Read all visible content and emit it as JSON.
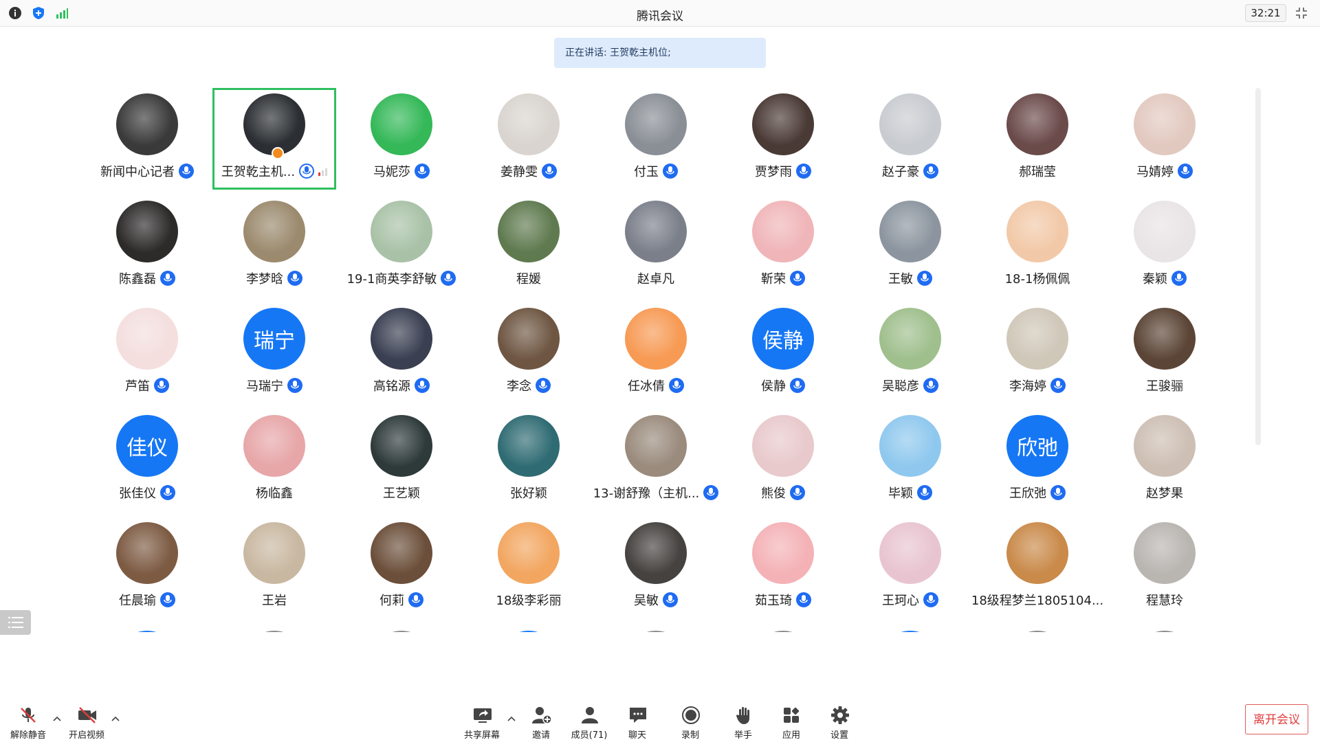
{
  "window": {
    "title": "腾讯会议",
    "timer": "32:21",
    "icons": [
      "info-icon",
      "shield-icon",
      "signal-icon",
      "fullscreen-icon"
    ]
  },
  "banner": {
    "text": "正在讲话: 王贺乾主机位;"
  },
  "colors": {
    "accent": "#1677f5",
    "active_border": "#2fbf5f",
    "banner_bg": "#deebfc",
    "leave": "#e03c3c",
    "host_badge": "#f28b1d"
  },
  "participants": [
    {
      "name": "新闻中心记者",
      "mic": true,
      "bg": "#3a3a3a"
    },
    {
      "name": "王贺乾主机...",
      "mic": "outline",
      "bg": "#2b2f33",
      "active": true,
      "host": true,
      "signal": true
    },
    {
      "name": "马妮莎",
      "mic": true,
      "bg": "#34b858"
    },
    {
      "name": "姜静雯",
      "mic": true,
      "bg": "#d9d4cf"
    },
    {
      "name": "付玉",
      "mic": true,
      "bg": "#8a8f96"
    },
    {
      "name": "贾梦雨",
      "mic": true,
      "bg": "#4a3a36"
    },
    {
      "name": "赵子豪",
      "mic": true,
      "bg": "#c8cbd0"
    },
    {
      "name": "郝瑞莹",
      "mic": false,
      "bg": "#6b4a4a"
    },
    {
      "name": "马婧婷",
      "mic": true,
      "bg": "#e2c9c0"
    },
    {
      "name": "陈鑫磊",
      "mic": true,
      "bg": "#2d2a2a"
    },
    {
      "name": "李梦晗",
      "mic": true,
      "bg": "#9b8a6e"
    },
    {
      "name": "19-1商英李舒敏",
      "mic": true,
      "bg": "#a9c2a7"
    },
    {
      "name": "程媛",
      "mic": false,
      "bg": "#5f7a4f"
    },
    {
      "name": "赵卓凡",
      "mic": false,
      "bg": "#7b7f8a"
    },
    {
      "name": "靳荣",
      "mic": true,
      "bg": "#f0b5b8"
    },
    {
      "name": "王敏",
      "mic": true,
      "bg": "#8c959f"
    },
    {
      "name": "18-1杨佩佩",
      "mic": false,
      "bg": "#f2c9a8"
    },
    {
      "name": "秦颖",
      "mic": true,
      "bg": "#e9e4e6"
    },
    {
      "name": "芦笛",
      "mic": true,
      "bg": "#f4dede"
    },
    {
      "name": "马瑞宁",
      "mic": true,
      "text": "瑞宁"
    },
    {
      "name": "高铭源",
      "mic": true,
      "bg": "#3a3f52"
    },
    {
      "name": "李念",
      "mic": true,
      "bg": "#6e5642"
    },
    {
      "name": "任冰倩",
      "mic": true,
      "bg": "#f79a54"
    },
    {
      "name": "侯静",
      "mic": true,
      "text": "侯静"
    },
    {
      "name": "吴聪彦",
      "mic": true,
      "bg": "#9fbf8d"
    },
    {
      "name": "李海婷",
      "mic": true,
      "bg": "#cfc7b8"
    },
    {
      "name": "王骏骊",
      "mic": false,
      "bg": "#5b4536"
    },
    {
      "name": "张佳仪",
      "mic": true,
      "text": "佳仪"
    },
    {
      "name": "杨临鑫",
      "mic": false,
      "bg": "#e7a6a8"
    },
    {
      "name": "王艺颖",
      "mic": false,
      "bg": "#2e3a3a"
    },
    {
      "name": "张好颖",
      "mic": false,
      "bg": "#2f6b73"
    },
    {
      "name": "13-谢舒豫（主机...",
      "mic": true,
      "bg": "#9a8b7d"
    },
    {
      "name": "熊俊",
      "mic": true,
      "bg": "#e8c9cc"
    },
    {
      "name": "毕颖",
      "mic": true,
      "bg": "#8fc8ee"
    },
    {
      "name": "王欣弛",
      "mic": true,
      "text": "欣弛"
    },
    {
      "name": "赵梦果",
      "mic": false,
      "bg": "#cdbfb4"
    },
    {
      "name": "任晨瑜",
      "mic": true,
      "bg": "#7d5b43"
    },
    {
      "name": "王岩",
      "mic": false,
      "bg": "#c9b8a1"
    },
    {
      "name": "何莉",
      "mic": true,
      "bg": "#6b4f3a"
    },
    {
      "name": "18级李彩丽",
      "mic": false,
      "bg": "#f2a660"
    },
    {
      "name": "吴敏",
      "mic": true,
      "bg": "#45423f"
    },
    {
      "name": "茹玉琦",
      "mic": true,
      "bg": "#f4b2b6"
    },
    {
      "name": "王珂心",
      "mic": true,
      "bg": "#e8c4d1"
    },
    {
      "name": "18级程梦兰1805104...",
      "mic": false,
      "bg": "#c98a4a"
    },
    {
      "name": "程慧玲",
      "mic": false,
      "bg": "#b9b5b1"
    }
  ],
  "toolbar": {
    "unmute": "解除静音",
    "start_video": "开启视频",
    "share_screen": "共享屏幕",
    "invite": "邀请",
    "members": "成员(71)",
    "chat": "聊天",
    "record": "录制",
    "raise_hand": "举手",
    "apps": "应用",
    "settings": "设置",
    "leave": "离开会议"
  }
}
